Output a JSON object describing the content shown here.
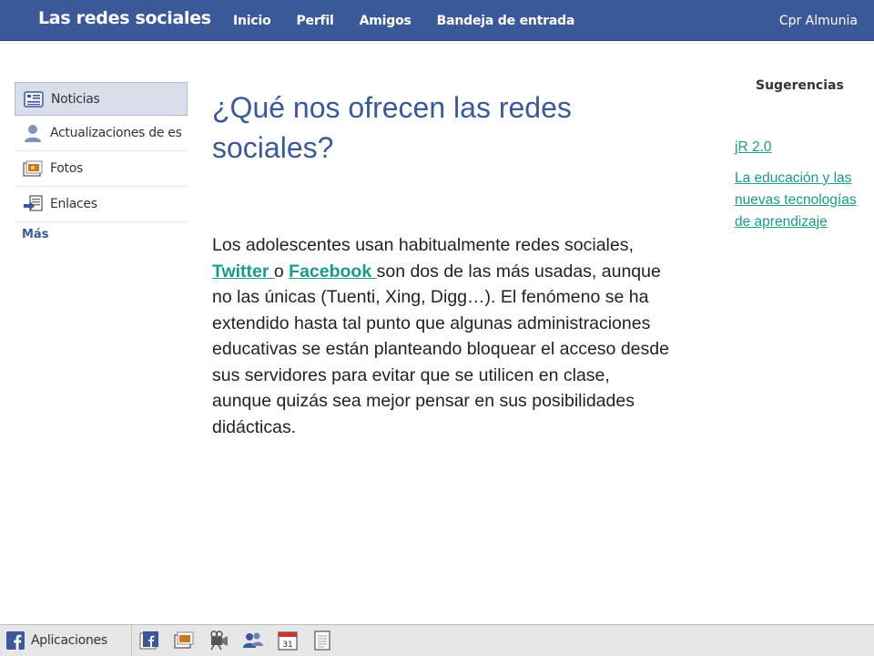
{
  "topbar": {
    "brand": "Las redes sociales",
    "nav": [
      {
        "label": "Inicio"
      },
      {
        "label": "Perfil"
      },
      {
        "label": "Amigos"
      },
      {
        "label": "Bandeja de entrada"
      }
    ],
    "user": "Cpr Almunia"
  },
  "sidebar": {
    "items": [
      {
        "label": "Noticias",
        "icon": "news-feed-icon",
        "selected": true
      },
      {
        "label": "Actualizaciones de es",
        "icon": "user-icon",
        "selected": false
      },
      {
        "label": "Fotos",
        "icon": "photos-icon",
        "selected": false
      },
      {
        "label": "Enlaces",
        "icon": "links-icon",
        "selected": false
      }
    ],
    "more": "Más"
  },
  "main": {
    "title": "¿Qué nos ofrecen las redes sociales?",
    "body": {
      "part1": "Los adolescentes usan habitualmente redes sociales, ",
      "link1": "Twitter ",
      "part2": "o ",
      "link2": "Facebook ",
      "part3": "son dos de las más usadas, aunque no las únicas (Tuenti, Xing, Digg…). El fenómeno se ha extendido hasta tal punto que algunas administraciones educativas se están planteando bloquear el acceso desde sus servidores para evitar que se utilicen en clase, aunque quizás sea mejor pensar en sus posibilidades didácticas."
    }
  },
  "suggestions": {
    "heading": "Sugerencias",
    "links": [
      {
        "label": "jR 2.0"
      },
      {
        "label": "La educación y las nuevas tecnologías de aprendizaje"
      }
    ]
  },
  "bottombar": {
    "apps_label": "Aplicaciones",
    "calendar_day": "31",
    "tray": [
      "facebook-app-icon",
      "photos-app-icon",
      "video-app-icon",
      "friends-app-icon",
      "calendar-icon",
      "notes-icon"
    ]
  },
  "colors": {
    "brand_blue": "#3b5998",
    "link_teal": "#1a9a8c",
    "selected_bg": "#d8dfea"
  }
}
